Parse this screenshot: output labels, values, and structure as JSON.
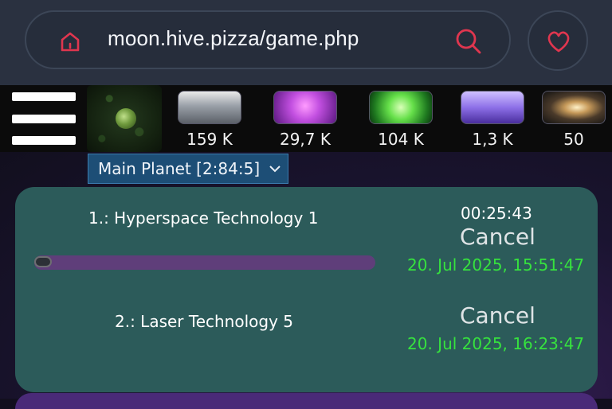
{
  "browser": {
    "url": "moon.hive.pizza/game.php",
    "icons": {
      "home": "home-icon",
      "search": "search-icon",
      "favorite": "heart-icon"
    },
    "accent_color": "#e0364f"
  },
  "resources": [
    {
      "name": "metal",
      "icon": "metal-icon",
      "value": "159 K"
    },
    {
      "name": "crystal",
      "icon": "crystal-icon",
      "value": "29,7 K"
    },
    {
      "name": "deuterium",
      "icon": "deuterium-icon",
      "value": "104 K"
    },
    {
      "name": "energy",
      "icon": "energy-icon",
      "value": "1,3 K"
    },
    {
      "name": "dark-matter",
      "icon": "dark-matter-icon",
      "value": "50"
    }
  ],
  "planet_select": {
    "selected": "Main Planet [2:84:5]"
  },
  "queue": [
    {
      "name": "1.: Hyperspace Technology 1",
      "timer": "00:25:43",
      "cancel_label": "Cancel",
      "finish": "20. Jul 2025, 15:51:47",
      "progress": 0.05
    },
    {
      "name": "2.: Laser Technology 5",
      "cancel_label": "Cancel",
      "finish": "20. Jul 2025, 16:23:47"
    }
  ],
  "colors": {
    "panel": "#2c5b5a",
    "finish_time": "#36e23e",
    "progress_track": "#5f3e7a"
  }
}
